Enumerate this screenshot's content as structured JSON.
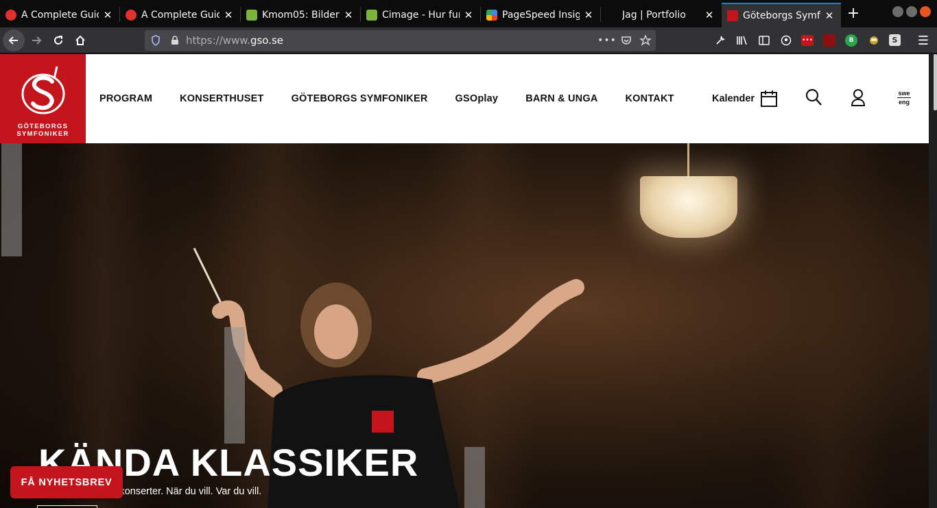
{
  "browser": {
    "tabs": [
      {
        "title": "A Complete Guid",
        "icon": "bug-icon",
        "color": "#e0312d"
      },
      {
        "title": "A Complete Guid",
        "icon": "bug-icon",
        "color": "#e0312d"
      },
      {
        "title": "Kmom05: Bilder |",
        "icon": "leaf-icon",
        "color": "#7bb33b"
      },
      {
        "title": "Cimage - Hur fung",
        "icon": "leaf-icon",
        "color": "#7bb33b"
      },
      {
        "title": "PageSpeed Insigh",
        "icon": "pagespeed-icon",
        "color": "#4285f4"
      },
      {
        "title": "Jag | Portfolio",
        "icon": "blank-icon",
        "color": "#0c0c0d"
      },
      {
        "title": "Göteborgs Symfo",
        "icon": "gso-icon",
        "color": "#c4151c"
      }
    ],
    "close_glyph": "✕",
    "newtab_glyph": "+",
    "url_scheme": "https://www.",
    "url_host": "gso.se",
    "menu_glyph": "☰"
  },
  "site": {
    "brand_color": "#c4151c",
    "logo_line1": "GÖTEBORGS",
    "logo_line2": "SYMFONIKER",
    "nav": [
      {
        "label": "PROGRAM"
      },
      {
        "label": "KONSERTHUSET"
      },
      {
        "label": "GÖTEBORGS SYMFONIKER"
      },
      {
        "label": "GSOplay"
      },
      {
        "label": "BARN & UNGA"
      },
      {
        "label": "KONTAKT"
      }
    ],
    "calendar_label": "Kalender",
    "lang_current": "swe",
    "lang_other": "eng"
  },
  "hero": {
    "title": "KÄNDA KLASSIKER",
    "subtitle": "...dat med digitala konserter. När du vill. Var du vill.",
    "newsletter_label": "FÅ NYHETSBREV"
  }
}
